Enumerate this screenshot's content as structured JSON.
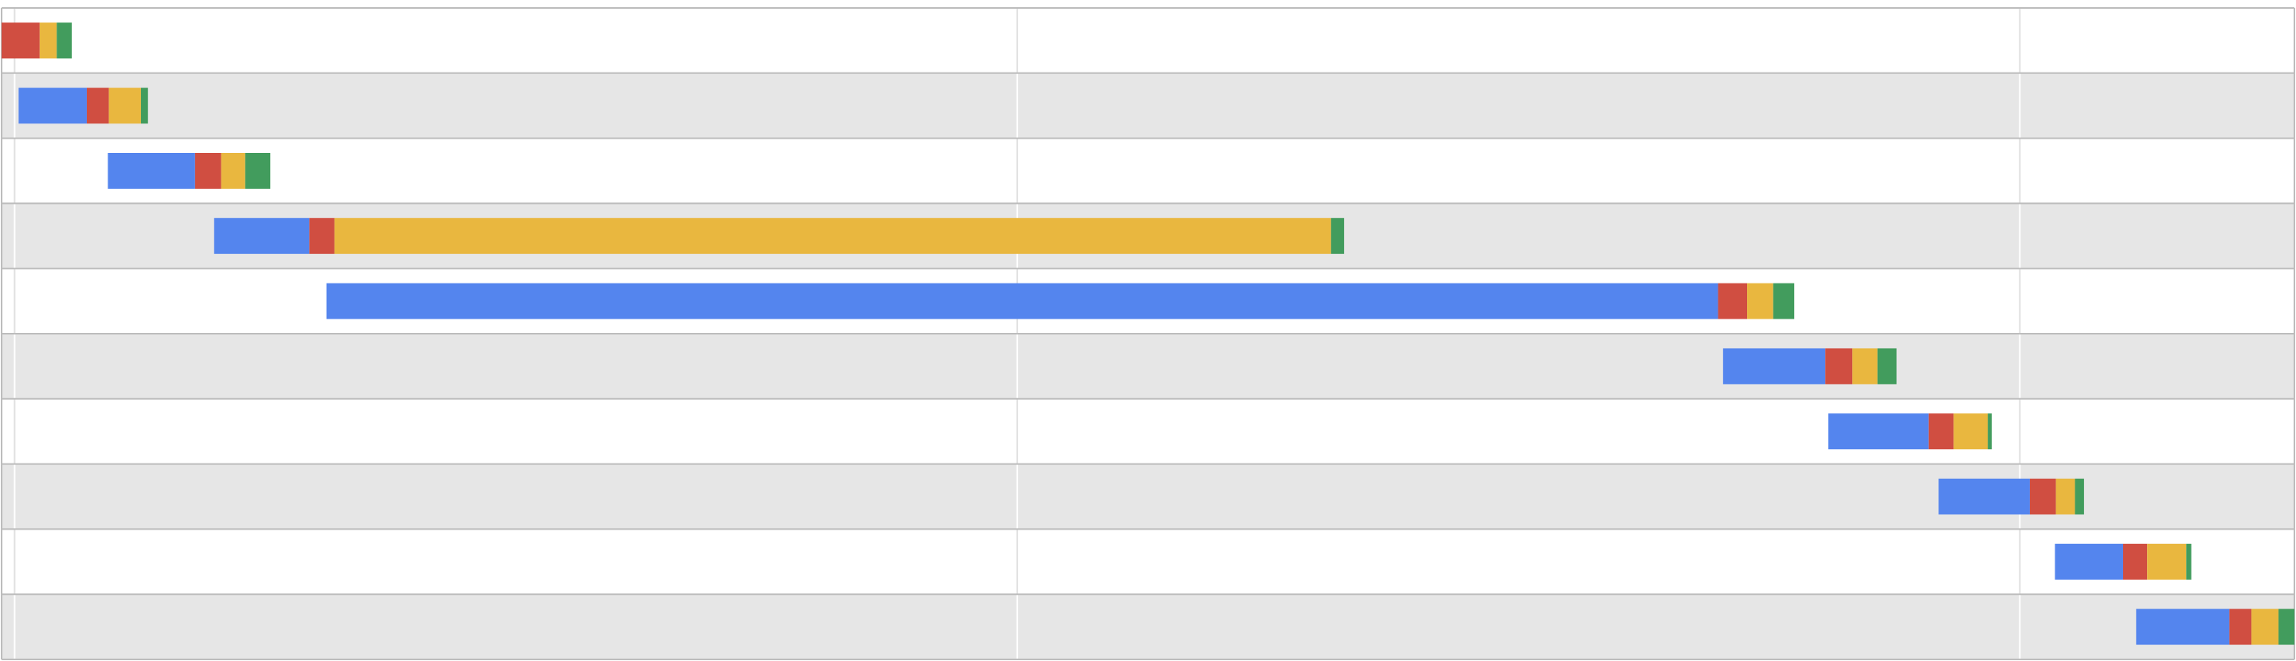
{
  "colors": {
    "segments": [
      "#5485ee",
      "#d04e41",
      "#e9b73f",
      "#429c5d"
    ],
    "row_even": "#ffffff",
    "row_odd": "#e6e6e6",
    "row_border": "#bdbdbd",
    "grid": "#ffffff",
    "grid_on_white": "#e0e0e0"
  },
  "chart_data": {
    "type": "bar",
    "subtype": "gantt-stacked-waterfall",
    "orientation": "horizontal",
    "title": "",
    "xlabel": "",
    "ylabel": "",
    "grid": true,
    "legend": "none",
    "tick_labels_shown": false,
    "xlim": [
      -0.13,
      21.1
    ],
    "gridlines_x": [
      0,
      10,
      20
    ],
    "rows": [
      {
        "start": -0.13,
        "segments": [
          0.0,
          0.38,
          0.17,
          0.15
        ]
      },
      {
        "start": 0.04,
        "segments": [
          0.68,
          0.22,
          0.32,
          0.07
        ]
      },
      {
        "start": 0.93,
        "segments": [
          0.87,
          0.26,
          0.24,
          0.25
        ]
      },
      {
        "start": 1.99,
        "segments": [
          0.95,
          0.25,
          9.94,
          0.13
        ]
      },
      {
        "start": 3.11,
        "segments": [
          13.88,
          0.29,
          0.26,
          0.21
        ]
      },
      {
        "start": 17.04,
        "segments": [
          1.02,
          0.27,
          0.25,
          0.19
        ]
      },
      {
        "start": 18.09,
        "segments": [
          1.0,
          0.25,
          0.34,
          0.04
        ]
      },
      {
        "start": 19.19,
        "segments": [
          0.91,
          0.26,
          0.19,
          0.09
        ]
      },
      {
        "start": 20.35,
        "segments": [
          0.68,
          0.24,
          0.39,
          0.05
        ]
      },
      {
        "start": 21.16,
        "segments": [
          0.93,
          0.22,
          0.27,
          0.19
        ]
      }
    ]
  }
}
